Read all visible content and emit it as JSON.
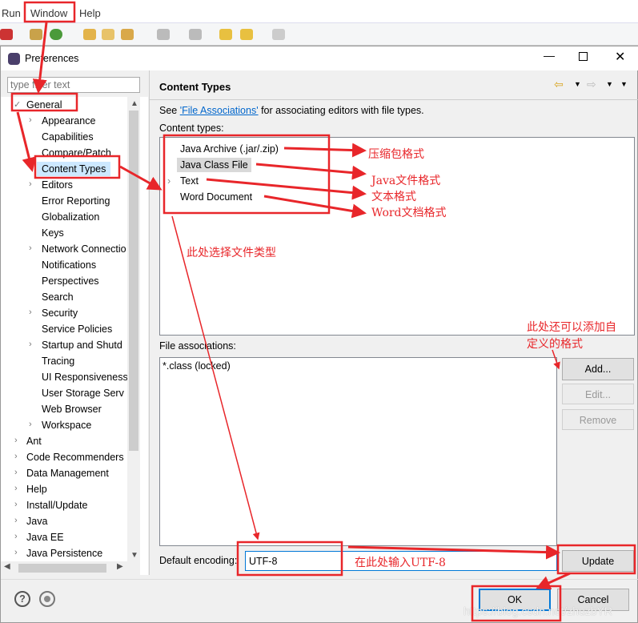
{
  "menubar": {
    "items": [
      "Run",
      "Window",
      "Help"
    ]
  },
  "dialog": {
    "title": "Preferences",
    "filter_placeholder": "type filter text"
  },
  "tree": {
    "general": "General",
    "general_children": [
      {
        "label": "Appearance",
        "expandable": true
      },
      {
        "label": "Capabilities"
      },
      {
        "label": "Compare/Patch"
      },
      {
        "label": "Content Types",
        "selected": true
      },
      {
        "label": "Editors",
        "expandable": true
      },
      {
        "label": "Error Reporting"
      },
      {
        "label": "Globalization"
      },
      {
        "label": "Keys"
      },
      {
        "label": "Network Connectio",
        "expandable": true
      },
      {
        "label": "Notifications"
      },
      {
        "label": "Perspectives"
      },
      {
        "label": "Search"
      },
      {
        "label": "Security",
        "expandable": true
      },
      {
        "label": "Service Policies"
      },
      {
        "label": "Startup and Shutd",
        "expandable": true
      },
      {
        "label": "Tracing"
      },
      {
        "label": "UI Responsiveness"
      },
      {
        "label": "User Storage Serv"
      },
      {
        "label": "Web Browser"
      },
      {
        "label": "Workspace",
        "expandable": true
      }
    ],
    "top_level": [
      "Ant",
      "Code Recommenders",
      "Data Management",
      "Help",
      "Install/Update",
      "Java",
      "Java EE",
      "Java Persistence"
    ]
  },
  "page": {
    "title": "Content Types",
    "see_prefix": "See ",
    "see_link": "'File Associations'",
    "see_suffix": " for associating editors with file types.",
    "content_types_label": "Content types:",
    "content_types": [
      {
        "label": "Java Archive (.jar/.zip)"
      },
      {
        "label": "Java Class File",
        "selected": true
      },
      {
        "label": "Text",
        "expandable": true
      },
      {
        "label": "Word Document"
      }
    ],
    "file_assoc_label": "File associations:",
    "file_assoc": [
      "*.class (locked)"
    ],
    "add": "Add...",
    "edit": "Edit...",
    "remove": "Remove",
    "encoding_label": "Default encoding:",
    "encoding_value": "UTF-8",
    "update": "Update"
  },
  "footer": {
    "ok": "OK",
    "cancel": "Cancel"
  },
  "annotations": {
    "archive": "压缩包格式",
    "class": "Java文件格式",
    "text": "文本格式",
    "word": "Word文档格式",
    "select": "此处选择文件类型",
    "custom1": "此处还可以添加自",
    "custom2": "定义的格式",
    "input": "在此处输入UTF-8"
  },
  "watermark": "https://blog.csdn.net/zhuzbYR",
  "colors": {
    "annotation": "#e8262a",
    "link": "#0066cc",
    "selection": "#cce8ff",
    "focus": "#0078d7"
  }
}
